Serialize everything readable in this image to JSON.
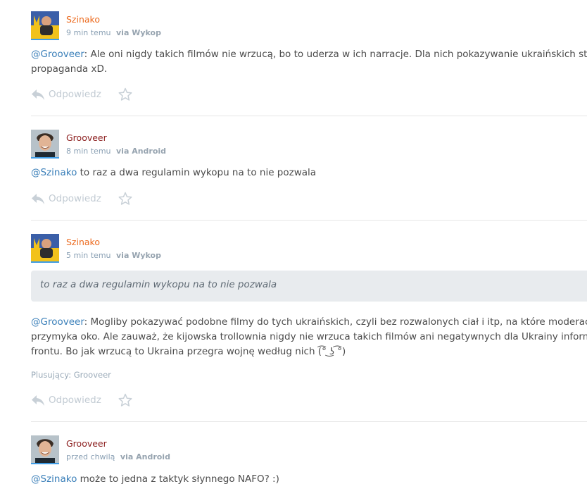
{
  "colors": {
    "author_wykop": "#ec6a1e",
    "author_android": "#8b1d1d",
    "mention": "#3a7fb9",
    "avatar_underline": "#3f9de6"
  },
  "comments": [
    {
      "author": "Szinako",
      "time": "9 min temu",
      "via": "via Wykop",
      "mention": "@Grooveer",
      "text_line1": ": Ale oni nigdy takich filmów nie wrzucą, bo to uderza w ich narracje. Dla nich pokazywanie ukraińskich strat",
      "text_line2": "propaganda xD.",
      "reply_label": "Odpowiedz"
    },
    {
      "author": "Grooveer",
      "time": "8 min temu",
      "via": "via Android",
      "mention": "@Szinako",
      "text_line1": " to raz a dwa regulamin wykopu na to nie pozwala",
      "reply_label": "Odpowiedz"
    },
    {
      "author": "Szinako",
      "time": "5 min temu",
      "via": "via Wykop",
      "quote": "to raz a dwa regulamin wykopu na to nie pozwala",
      "mention": "@Grooveer",
      "text_line1": ": Mogliby pokazywać podobne filmy do tych ukraińskich, czyli bez rozwalonych ciał i itp, na które moderacja",
      "text_line2": "przymyka oko. Ale zauważ, że kijowska trollownia nigdy nie wrzuca takich filmów ani negatywnych dla Ukrainy informac",
      "text_line3": "frontu. Bo jak wrzucą to Ukraina przegra wojnę według nich (͡° ͜ʖ ͡°)",
      "plusers": "Plusujący: Grooveer",
      "reply_label": "Odpowiedz"
    },
    {
      "author": "Grooveer",
      "time": "przed chwilą",
      "via": "via Android",
      "mention": "@Szinako",
      "text_line1": " może to jedna z taktyk słynnego NAFO? :)"
    }
  ],
  "icons": {
    "reply": "reply-arrow-icon",
    "favorite": "star-outline-icon",
    "avatar_szinako": "avatar-image",
    "avatar_grooveer": "avatar-image"
  }
}
